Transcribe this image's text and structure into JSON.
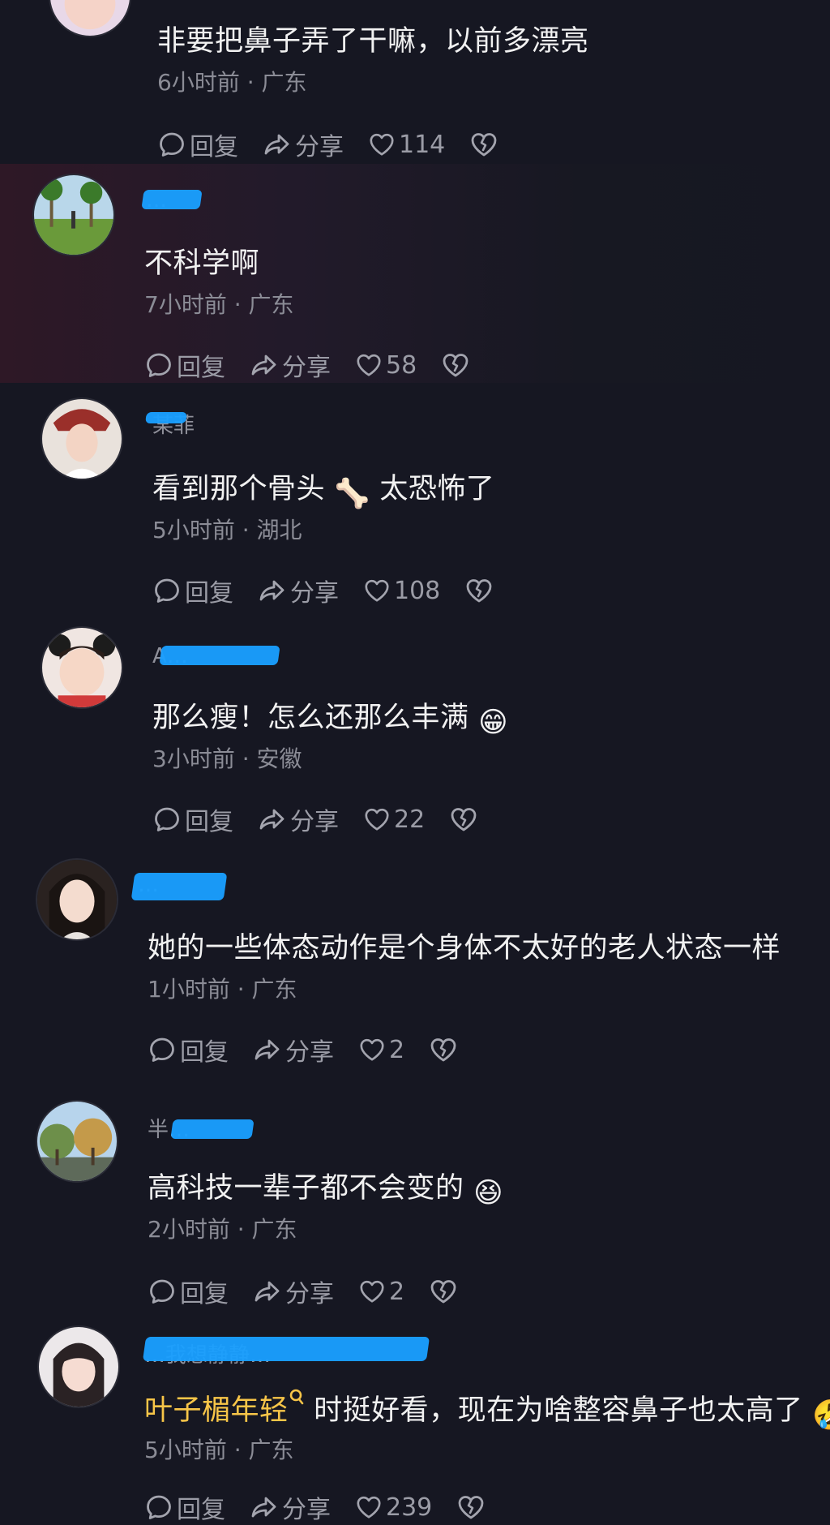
{
  "comments": [
    {
      "text": "非要把鼻子弄了干嘛，以前多漂亮",
      "time": "6小时前",
      "location": "广东",
      "reply": "回复",
      "share": "分享",
      "likes": "114"
    },
    {
      "username": "…",
      "text": "不科学啊",
      "time": "7小时前",
      "location": "广东",
      "reply": "回复",
      "share": "分享",
      "likes": "58"
    },
    {
      "username": "某菲",
      "text_a": "看到那个骨头",
      "text_b": "太恐怖了",
      "emoji": "🦴",
      "time": "5小时前",
      "location": "湖北",
      "reply": "回复",
      "share": "分享",
      "likes": "108"
    },
    {
      "username": "A…",
      "text": "那么瘦！怎么还那么丰满",
      "emoji": "😁",
      "time": "3小时前",
      "location": "安徽",
      "reply": "回复",
      "share": "分享",
      "likes": "22"
    },
    {
      "username": "…",
      "text": "她的一些体态动作是个身体不太好的老人状态一样",
      "time": "1小时前",
      "location": "广东",
      "reply": "回复",
      "share": "分享",
      "likes": "2"
    },
    {
      "username": "半…",
      "text": "高科技一辈子都不会变的",
      "emoji": "😆",
      "time": "2小时前",
      "location": "广东",
      "reply": "回复",
      "share": "分享",
      "likes": "2"
    },
    {
      "username": "…我想静静…",
      "link": "叶子楣年轻",
      "text": "时挺好看，现在为啥整容鼻子也太高了",
      "emoji": "🤣",
      "time": "5小时前",
      "location": "广东",
      "reply": "回复",
      "share": "分享",
      "likes": "239"
    }
  ],
  "separator": "·",
  "icons": {
    "reply": "comment-bubble-icon",
    "share": "share-arrow-icon",
    "like": "heart-icon",
    "dislike": "broken-heart-icon",
    "search": "search-icon"
  },
  "colors": {
    "background": "#161722",
    "text": "#f1f1f1",
    "meta": "#8b8c96",
    "link": "#f7c548",
    "redaction": "#1a9fff"
  }
}
